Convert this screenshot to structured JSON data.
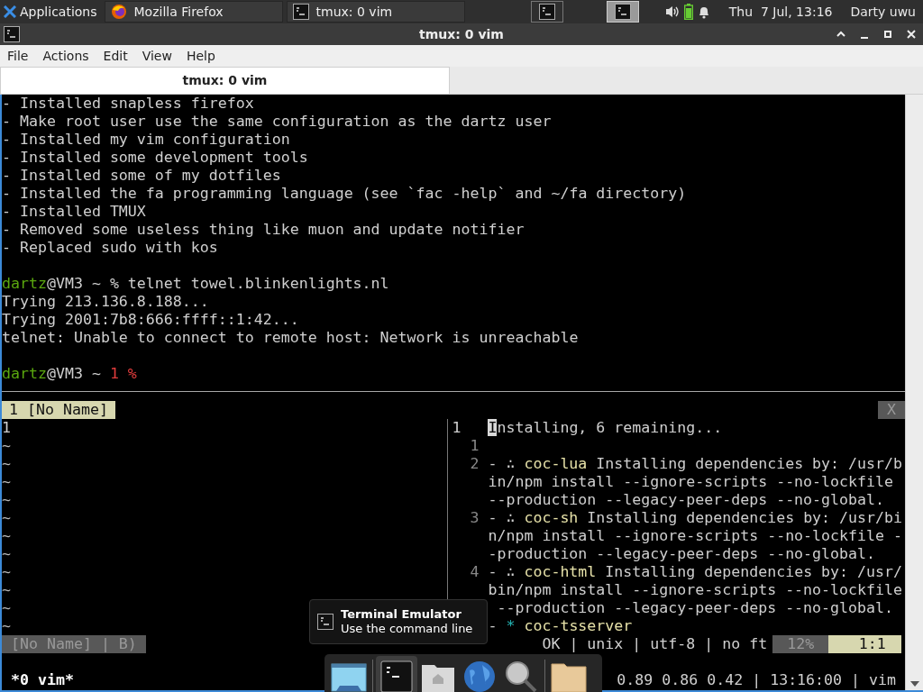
{
  "top_panel": {
    "applications": "Applications",
    "tasks": [
      {
        "label": "Mozilla Firefox"
      },
      {
        "label": "tmux: 0 vim"
      }
    ],
    "workspaces": [
      {
        "selected": false
      },
      {
        "selected": true
      }
    ],
    "clock": "Thu  7 Jul, 13:16",
    "user": "Darty uwu"
  },
  "window": {
    "title": "tmux: 0 vim",
    "menu": [
      "File",
      "Actions",
      "Edit",
      "View",
      "Help"
    ],
    "tabs": [
      {
        "label": "tmux: 0 vim",
        "selected": true
      }
    ]
  },
  "shell_lines": [
    {
      "segments": [
        {
          "text": "- Installed snapless firefox",
          "kind": "text"
        }
      ]
    },
    {
      "segments": [
        {
          "text": "- Make root user use the same configuration as the dartz user",
          "kind": "text"
        }
      ]
    },
    {
      "segments": [
        {
          "text": "- Installed my vim configuration",
          "kind": "text"
        }
      ]
    },
    {
      "segments": [
        {
          "text": "- Installed some development tools",
          "kind": "text"
        }
      ]
    },
    {
      "segments": [
        {
          "text": "- Installed some of my dotfiles",
          "kind": "text"
        }
      ]
    },
    {
      "segments": [
        {
          "text": "- Installed the fa programming language (see `fac -help` and ~/fa directory)",
          "kind": "text"
        }
      ]
    },
    {
      "segments": [
        {
          "text": "- Installed TMUX",
          "kind": "text"
        }
      ]
    },
    {
      "segments": [
        {
          "text": "- Removed some useless thing like muon and update notifier",
          "kind": "text"
        }
      ]
    },
    {
      "segments": [
        {
          "text": "- Replaced sudo with kos",
          "kind": "text"
        }
      ]
    },
    {
      "kind": "blank"
    },
    {
      "kind": "line",
      "segments": [
        {
          "text": "dartz",
          "kind": "user"
        },
        {
          "text": "@VM3 ~ % telnet towel.blinkenlights.nl",
          "kind": "text"
        }
      ]
    },
    {
      "segments": [
        {
          "text": "Trying 213.136.8.188...",
          "kind": "text"
        }
      ]
    },
    {
      "segments": [
        {
          "text": "Trying 2001:7b8:666:ffff::1:42...",
          "kind": "text"
        }
      ]
    },
    {
      "segments": [
        {
          "text": "telnet: Unable to connect to remote host: Network is unreachable",
          "kind": "text"
        }
      ]
    },
    {
      "kind": "blank"
    },
    {
      "kind": "line",
      "segments": [
        {
          "text": "dartz",
          "kind": "user"
        },
        {
          "text": "@VM3 ~ ",
          "kind": "text"
        },
        {
          "text": "1 %",
          "kind": "alert"
        }
      ]
    }
  ],
  "vim": {
    "tabline": {
      "label": "1 [No Name]",
      "close": "X"
    },
    "left_pane": {
      "lines": [
        "1",
        "~",
        "~",
        "~",
        "~",
        "~",
        "~",
        "~",
        "~",
        "~",
        "~",
        "~"
      ]
    },
    "right_pane": {
      "rows": [
        {
          "number": "1",
          "current": true,
          "segments": [
            {
              "text": "I",
              "kind": "cursor"
            },
            {
              "text": "nstalling, 6 remaining...",
              "kind": "text"
            }
          ]
        },
        {
          "number": "1",
          "current": false
        },
        {
          "number": "2",
          "current": false,
          "segments": [
            {
              "text": "- ∴ ",
              "kind": "text"
            },
            {
              "text": "coc-lua",
              "kind": "plugin"
            },
            {
              "text": " Installing dependencies by: /usr/b",
              "kind": "text"
            }
          ]
        },
        {
          "segments": [
            {
              "text": "in/npm install --ignore-scripts --no-lockfile",
              "kind": "text"
            }
          ]
        },
        {
          "segments": [
            {
              "text": "--production --legacy-peer-deps --no-global.",
              "kind": "text"
            }
          ]
        },
        {
          "number": "3",
          "current": false,
          "segments": [
            {
              "text": "- ∴ ",
              "kind": "text"
            },
            {
              "text": "coc-sh",
              "kind": "plugin"
            },
            {
              "text": " Installing dependencies by: /usr/bi",
              "kind": "text"
            }
          ]
        },
        {
          "segments": [
            {
              "text": "n/npm install --ignore-scripts --no-lockfile -",
              "kind": "text"
            }
          ]
        },
        {
          "segments": [
            {
              "text": "-production --legacy-peer-deps --no-global.",
              "kind": "text"
            }
          ]
        },
        {
          "number": "4",
          "current": false,
          "segments": [
            {
              "text": "- ∴ ",
              "kind": "text"
            },
            {
              "text": "coc-html",
              "kind": "plugin"
            },
            {
              "text": " Installing dependencies by: /usr/",
              "kind": "text"
            }
          ]
        },
        {
          "segments": [
            {
              "text": "bin/npm install --ignore-scripts --no-lockfile",
              "kind": "text"
            }
          ]
        },
        {
          "segments": [
            {
              "text": " --production --legacy-peer-deps --no-global.",
              "kind": "text"
            }
          ]
        },
        {
          "segments": [
            {
              "text": "- ",
              "kind": "text"
            },
            {
              "text": "*",
              "kind": "bullet"
            },
            {
              "text": " coc-tsserver",
              "kind": "plugin"
            }
          ]
        }
      ]
    },
    "statusline": {
      "left": "[No Name] | B)",
      "info": "OK | unix | utf-8 | no ft",
      "percent": "12%",
      "position": "1:1"
    }
  },
  "tmux_status": {
    "left": "*0 vim*",
    "right": "0.89 0.86 0.42 | 13:16:00 | vim"
  },
  "tooltip": {
    "title": "Terminal Emulator",
    "subtitle": "Use the command line"
  },
  "dock": [
    {
      "selected": false
    },
    {
      "selected": true
    },
    {
      "selected": false
    },
    {
      "selected": false
    },
    {
      "selected": false
    },
    {
      "selected": false
    }
  ]
}
